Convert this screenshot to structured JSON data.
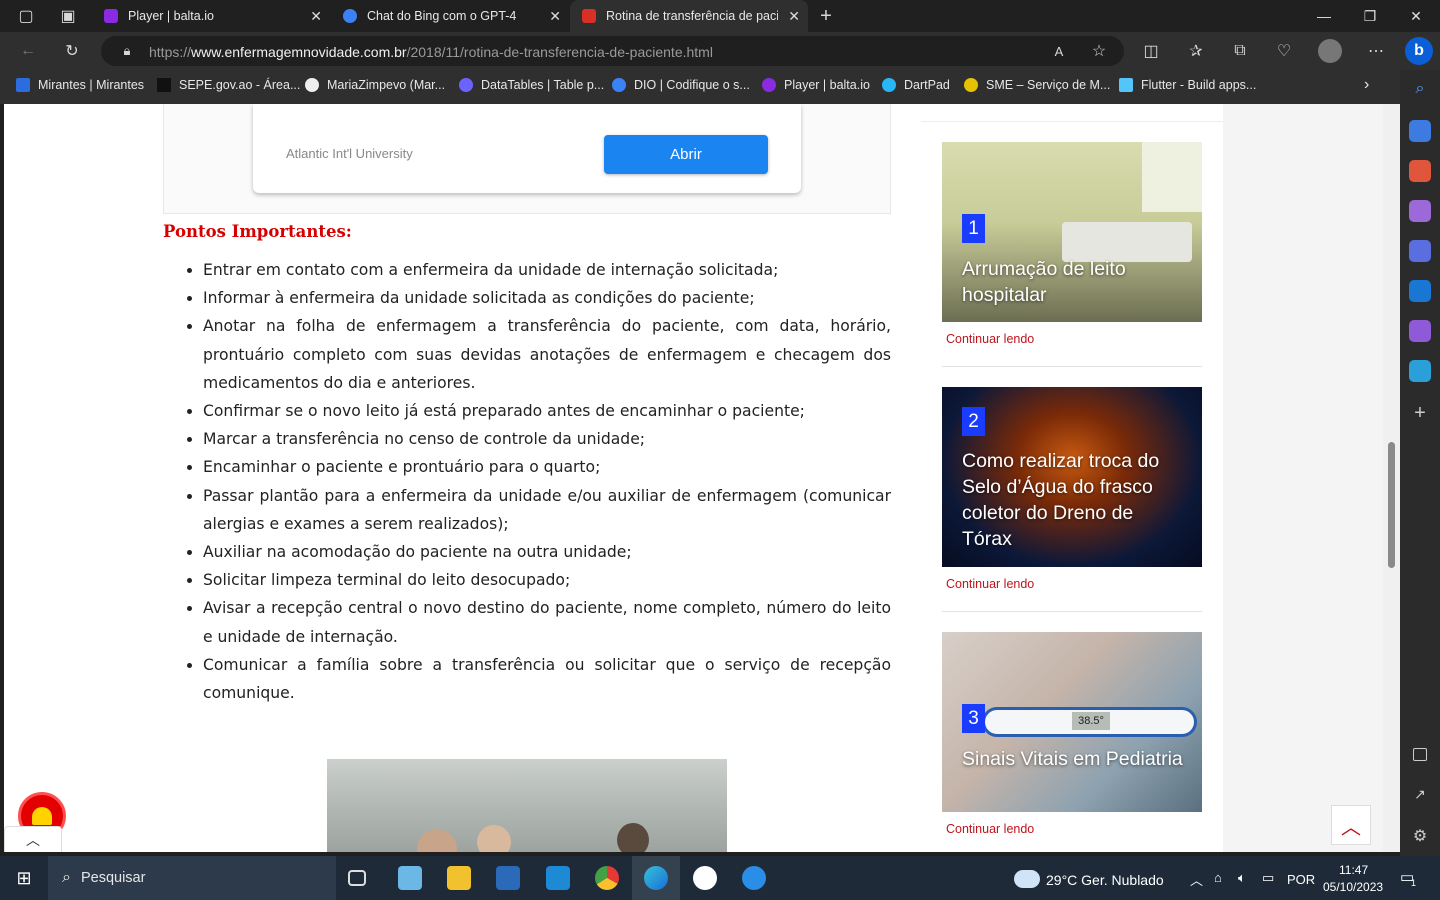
{
  "browser": {
    "tabs": [
      {
        "title": "Player | balta.io",
        "color": "#8a2be2"
      },
      {
        "title": "Chat do Bing com o GPT-4",
        "color": "#3b82f6"
      },
      {
        "title": "Rotina de transferência de pacie",
        "color": "#d93025"
      }
    ],
    "new_tab_label": "+",
    "url_prefix": "https://",
    "url_domain": "www.enfermagemnovidade.com.br",
    "url_path": "/2018/11/rotina-de-transferencia-de-paciente.html"
  },
  "bookmarks": [
    {
      "label": "Mirantes | Mirantes",
      "color": "#2d6cdf"
    },
    {
      "label": "SEPE.gov.ao - Área...",
      "color": "#111111"
    },
    {
      "label": "MariaZimpevo (Mar...",
      "color": "#eeeeee"
    },
    {
      "label": "DataTables | Table p...",
      "color": "#6c63ff"
    },
    {
      "label": "DIO | Codifique o s...",
      "color": "#3b82f6"
    },
    {
      "label": "Player | balta.io",
      "color": "#8a2be2"
    },
    {
      "label": "DartPad",
      "color": "#29b6f6"
    },
    {
      "label": "SME – Serviço de M...",
      "color": "#e6c200"
    },
    {
      "label": "Flutter - Build apps...",
      "color": "#54c5f8"
    }
  ],
  "ad": {
    "advertiser": "Atlantic Int'l University",
    "button": "Abrir"
  },
  "article": {
    "heading": "Pontos Importantes:",
    "items": [
      "Entrar em contato com a enfermeira da unidade de internação solicitada;",
      "Informar à enfermeira da unidade solicitada as condições do paciente;",
      "Anotar na folha de enfermagem a transferência do paciente, com data, horário, prontuário completo com suas devidas anotações de enfermagem e checagem dos medicamentos do dia e anteriores.",
      "Confirmar se o novo leito já está preparado antes de encaminhar o paciente;",
      "Marcar a transferência no censo de controle da unidade;",
      "Encaminhar o paciente e prontuário para o quarto;",
      "Passar plantão para a enfermeira da unidade e/ou auxiliar de enfermagem (comunicar alergias  e exames a serem realizados);",
      "Auxiliar na acomodação do paciente na outra unidade;",
      "Solicitar limpeza terminal do leito desocupado;",
      "Avisar a recepção central o novo destino do paciente, nome completo, número do leito e unidade de internação.",
      "Comunicar a família sobre a transferência ou solicitar que o serviço de recepção comunique."
    ]
  },
  "popular": [
    {
      "rank": "1",
      "title": "Arrumação de leito hospitalar",
      "more": "Continuar lendo"
    },
    {
      "rank": "2",
      "title": "Como realizar troca do Selo d’Água do frasco coletor do Dreno de Tórax",
      "more": "Continuar lendo"
    },
    {
      "rank": "3",
      "title": "Sinais Vitais em Pediatria",
      "more": "Continuar lendo",
      "thermometer": "38.5°"
    }
  ],
  "taskbar": {
    "search_placeholder": "Pesquisar",
    "weather": "29°C  Ger. Nublado",
    "language": "POR",
    "time": "11:47",
    "date": "05/10/2023",
    "notifications": "1"
  }
}
